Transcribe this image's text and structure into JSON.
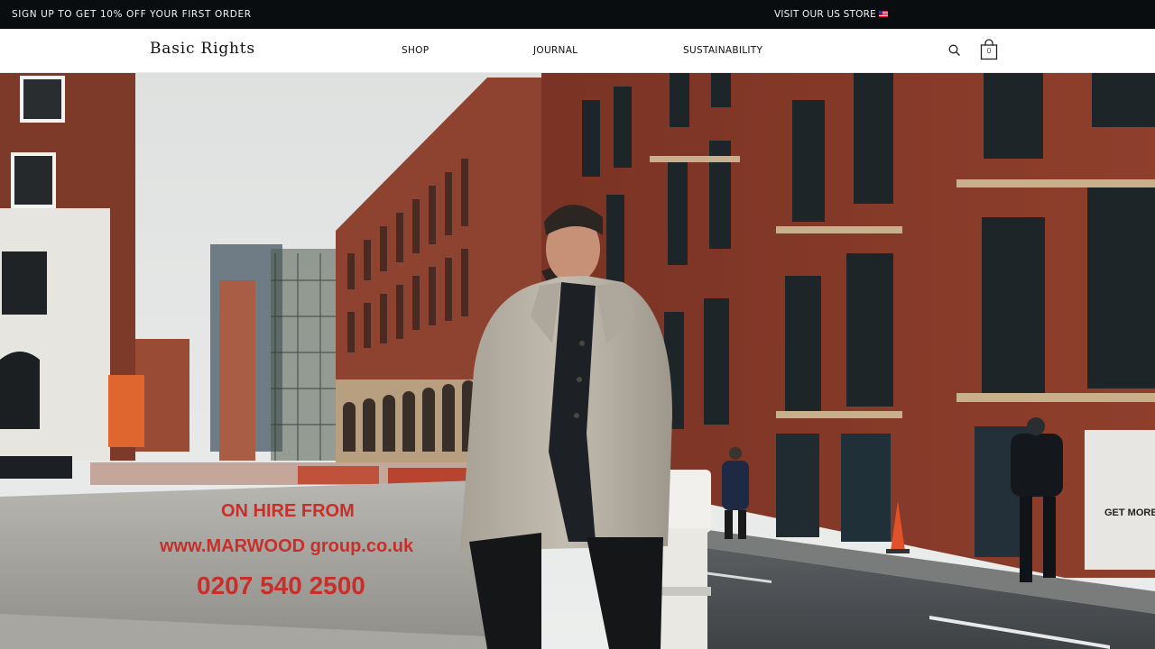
{
  "announcement": {
    "promo_text": "SIGN UP TO GET 10% OFF YOUR FIRST ORDER",
    "us_store_text": "VISIT OUR US STORE",
    "flag_icon": "us-flag-icon"
  },
  "header": {
    "logo": "Basic Rights",
    "nav": [
      {
        "label": "SHOP"
      },
      {
        "label": "JOURNAL"
      },
      {
        "label": "SUSTAINABILITY"
      }
    ],
    "search_icon": "search-icon",
    "bag_icon": "shopping-bag-icon",
    "bag_count": "0"
  },
  "hero": {
    "barrier": {
      "line1": "ON HIRE FROM",
      "line2": "www.MARWOOD group.co.uk",
      "line3": "0207 540 2500"
    },
    "poster_text": [
      "GET MORE"
    ],
    "colors": {
      "brick": "#8e3b2a",
      "sky": "#e4e6e5",
      "coat": "#b9b3a8",
      "barrier_text": "#c7302a"
    }
  }
}
